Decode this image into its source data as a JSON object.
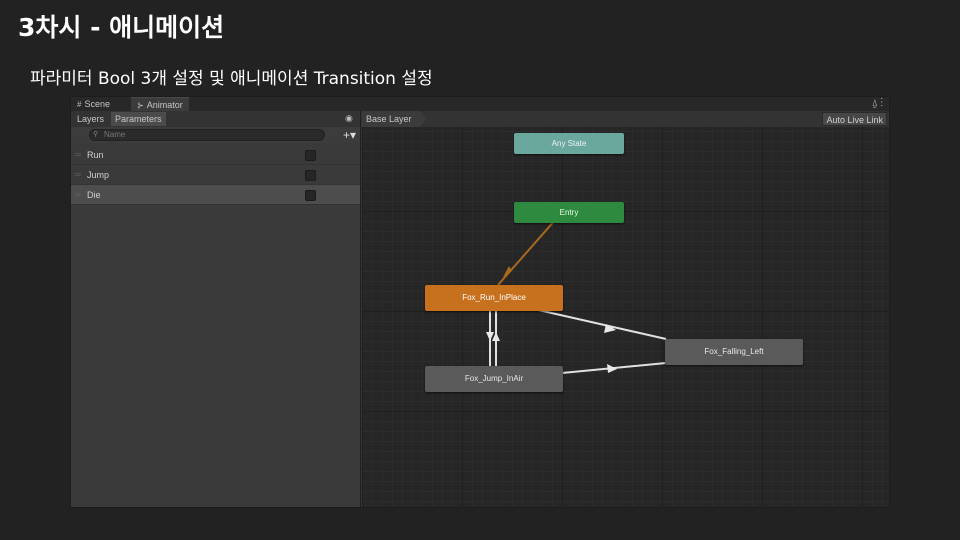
{
  "slide": {
    "title": "3차시 - 애니메이션",
    "subtitle": "파라미터 Bool 3개 설정 및 애니메이션 Transition 설정"
  },
  "editor": {
    "tabs": [
      {
        "label": "Scene",
        "icon": "scene-icon"
      },
      {
        "label": "Animator",
        "icon": "animator-icon"
      }
    ],
    "subtabs": [
      "Layers",
      "Parameters"
    ],
    "search_placeholder": "Name",
    "add_label": "+▾",
    "parameters": [
      {
        "name": "Run",
        "value": false
      },
      {
        "name": "Jump",
        "value": false
      },
      {
        "name": "Die",
        "value": false
      }
    ],
    "selected_parameter": "Die",
    "breadcrumb": "Base Layer",
    "live_link_label": "Auto Live Link",
    "states": {
      "any": "Any State",
      "entry": "Entry",
      "run": "Fox_Run_InPlace",
      "falling": "Fox_Falling_Left",
      "jump": "Fox_Jump_InAir"
    },
    "colors": {
      "any_state": "#6aa89d",
      "entry": "#2e8a3e",
      "default_state": "#c7711e",
      "state": "#5a5a5a"
    }
  }
}
